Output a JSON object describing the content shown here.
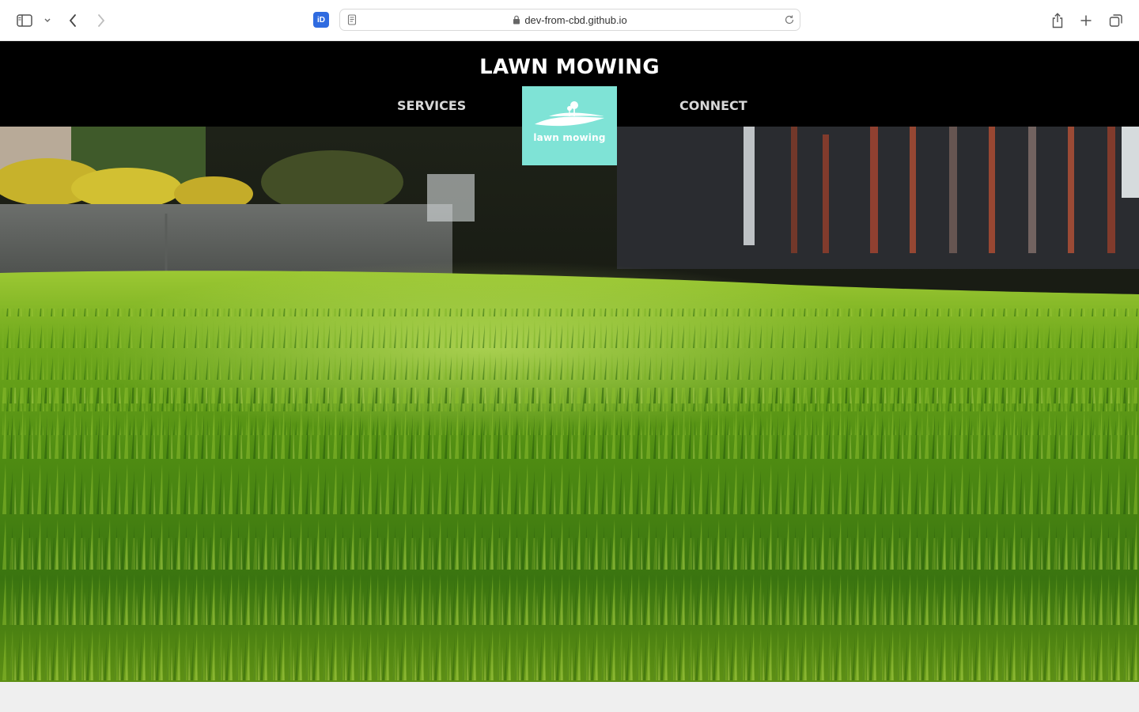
{
  "browser": {
    "url": "dev-from-cbd.github.io",
    "extension_label": "iD",
    "icons": [
      "sidebar-icon",
      "chevron-down-icon",
      "back-icon",
      "forward-icon",
      "reader-icon",
      "lock-icon",
      "reload-icon",
      "share-icon",
      "new-tab-icon",
      "tabs-overview-icon"
    ]
  },
  "site": {
    "title": "LAWN MOWING",
    "nav": {
      "services": "SERVICES",
      "connect": "CONNECT"
    },
    "logo": {
      "text": "lawn mowing",
      "color": "#7fe3d6"
    }
  },
  "hero": {
    "image": "grass-lawn-photo"
  },
  "colors": {
    "header_bg": "#000000",
    "nav_text": "#d8d8d8",
    "page_bg": "#efefef"
  }
}
